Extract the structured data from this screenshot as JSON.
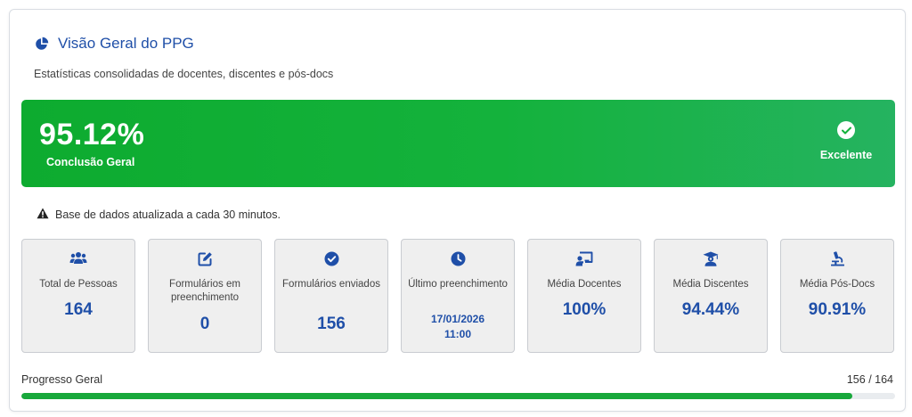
{
  "header": {
    "title": "Visão Geral do PPG",
    "subtitle": "Estatísticas consolidadas de docentes, discentes e pós-docs"
  },
  "hero": {
    "value": "95.12%",
    "label": "Conclusão Geral",
    "status": "Excelente"
  },
  "notice": "Base de dados atualizada a cada 30 minutos.",
  "stats": [
    {
      "icon": "users-icon",
      "label": "Total de Pessoas",
      "value": "164"
    },
    {
      "icon": "edit-icon",
      "label": "Formulários em preenchimento",
      "value": "0"
    },
    {
      "icon": "check-circle-icon",
      "label": "Formulários enviados",
      "value": "156"
    },
    {
      "icon": "clock-icon",
      "label": "Último preenchimento",
      "value_date": "17/01/2026",
      "value_time": "11:00"
    },
    {
      "icon": "chalkboard-teacher-icon",
      "label": "Média Docentes",
      "value": "100%"
    },
    {
      "icon": "graduation-cap-icon",
      "label": "Média Discentes",
      "value": "94.44%"
    },
    {
      "icon": "microscope-icon",
      "label": "Média Pós-Docs",
      "value": "90.91%"
    }
  ],
  "progress": {
    "label": "Progresso Geral",
    "count": "156 / 164",
    "fraction": 0.9512
  },
  "colors": {
    "accent": "#1f4fa8",
    "success": "#14b23c",
    "card_bg": "#efefef"
  }
}
